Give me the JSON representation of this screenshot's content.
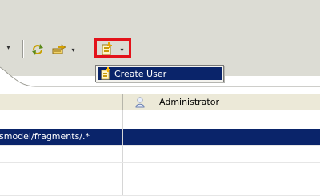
{
  "toolbar": {
    "icons": [
      "dropdown-arrow-icon",
      "refresh-icon",
      "export-icon",
      "new-user-icon"
    ],
    "accent_highlight": "#e3121a"
  },
  "menu": {
    "items": [
      {
        "label": "Create User",
        "icon": "new-user-icon"
      }
    ],
    "selected_bg": "#0a246a"
  },
  "table": {
    "columns": [
      "",
      "Administrator"
    ],
    "column_icon": "user-icon",
    "rows": [
      {
        "pattern": "smodel/fragments/.*",
        "admin": ""
      },
      {
        "pattern": "",
        "admin": ""
      },
      {
        "pattern": "",
        "admin": ""
      },
      {
        "pattern": "",
        "admin": ""
      }
    ]
  }
}
